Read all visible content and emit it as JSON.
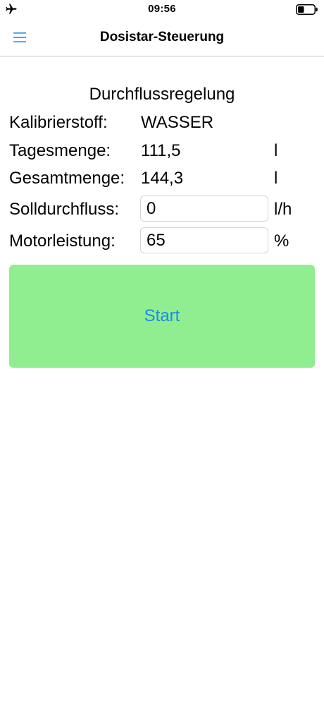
{
  "status_bar": {
    "time": "09:56",
    "airplane_icon": "airplane-icon",
    "battery_icon": "battery-icon"
  },
  "nav": {
    "title": "Dosistar-Steuerung",
    "menu_icon": "hamburger-menu-icon"
  },
  "section_title": "Durchflussregelung",
  "rows": {
    "kalibrierstoff": {
      "label": "Kalibrierstoff:",
      "value": "WASSER"
    },
    "tagesmenge": {
      "label": "Tagesmenge:",
      "value": "111,5",
      "unit": "l"
    },
    "gesamtmenge": {
      "label": "Gesamtmenge:",
      "value": "144,3",
      "unit": "l"
    },
    "solldurchfluss": {
      "label": "Solldurchfluss:",
      "value": "0",
      "unit": "l/h"
    },
    "motorleistung": {
      "label": "Motorleistung:",
      "value": "65",
      "unit": "%"
    }
  },
  "start_button": {
    "label": "Start"
  },
  "colors": {
    "accent": "#1a8ce8",
    "start_button_bg": "#90ee90",
    "divider": "#c8c8cc"
  }
}
